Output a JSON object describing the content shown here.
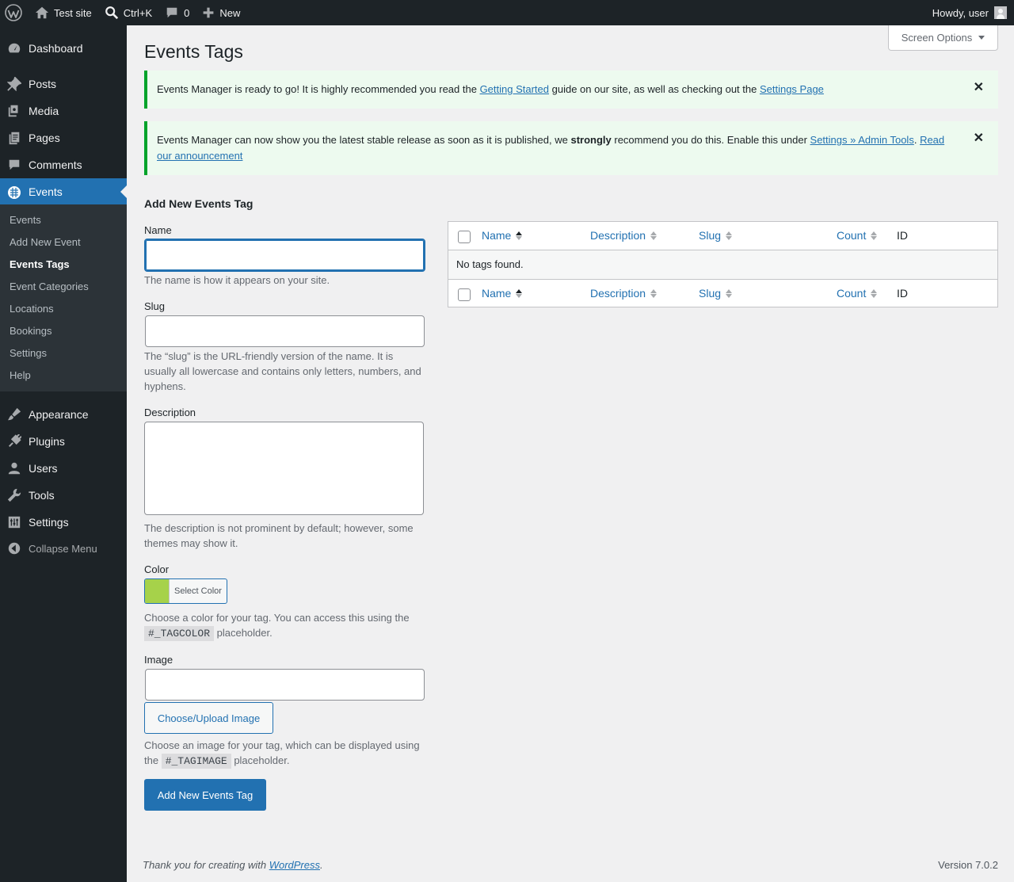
{
  "adminbar": {
    "site_name": "Test site",
    "search_shortcut": "Ctrl+K",
    "comments_count": "0",
    "new_label": "New",
    "howdy": "Howdy, user"
  },
  "sidebar": {
    "items": [
      {
        "label": "Dashboard",
        "icon": "dashboard-icon"
      },
      {
        "label": "Posts",
        "icon": "pin-icon"
      },
      {
        "label": "Media",
        "icon": "media-icon"
      },
      {
        "label": "Pages",
        "icon": "pages-icon"
      },
      {
        "label": "Comments",
        "icon": "comment-icon"
      },
      {
        "label": "Events",
        "icon": "calendar-icon"
      },
      {
        "label": "Appearance",
        "icon": "brush-icon"
      },
      {
        "label": "Plugins",
        "icon": "plug-icon"
      },
      {
        "label": "Users",
        "icon": "user-icon"
      },
      {
        "label": "Tools",
        "icon": "wrench-icon"
      },
      {
        "label": "Settings",
        "icon": "sliders-icon"
      }
    ],
    "submenu": [
      "Events",
      "Add New Event",
      "Events Tags",
      "Event Categories",
      "Locations",
      "Bookings",
      "Settings",
      "Help"
    ],
    "collapse_label": "Collapse Menu"
  },
  "screen_options": "Screen Options",
  "page_title": "Events Tags",
  "notices": {
    "n1": {
      "before": "Events Manager is ready to go! It is highly recommended you read the ",
      "link1": "Getting Started",
      "middle": " guide on our site, as well as checking out the ",
      "link2": "Settings Page"
    },
    "n2": {
      "before": "Events Manager can now show you the latest stable release as soon as it is published, we ",
      "strong": "strongly",
      "middle": " recommend you do this. Enable this under ",
      "link1": "Settings » Admin Tools",
      "after": ". ",
      "link2a": "Read",
      "link2b": "our announcement"
    },
    "dismiss": "✕"
  },
  "form": {
    "title": "Add New Events Tag",
    "name_label": "Name",
    "name_value": "",
    "name_help": "The name is how it appears on your site.",
    "slug_label": "Slug",
    "slug_value": "",
    "slug_help_1": "The “slug” is the URL-friendly version of the name. It is",
    "slug_help_2": "usually all lowercase and contains only letters, numbers, and",
    "slug_help_3": "hyphens.",
    "description_label": "Description",
    "description_value": "",
    "description_help_1": "The description is not prominent by default; however, some",
    "description_help_2": "themes may show it.",
    "color_label": "Color",
    "color_value": "#a6d24a",
    "color_button": "Select Color",
    "color_help_1": "Choose a color for your tag. You can access this using the",
    "color_placeholder": "#_TAGCOLOR",
    "color_help_2": " placeholder.",
    "image_label": "Image",
    "image_value": "",
    "upload_button": "Choose/Upload Image",
    "image_help_1": "Choose an image for your tag, which can be displayed using",
    "image_help_2a": "the ",
    "image_placeholder": "#_TAGIMAGE",
    "image_help_2b": " placeholder.",
    "submit_button": "Add New Events Tag"
  },
  "table": {
    "columns": [
      "Name",
      "Description",
      "Slug",
      "Count",
      "ID"
    ],
    "empty_message": "No tags found."
  },
  "footer": {
    "thanks_before": "Thank you for creating with ",
    "thanks_link": "WordPress",
    "thanks_after": ".",
    "version": "Version 7.0.2"
  }
}
